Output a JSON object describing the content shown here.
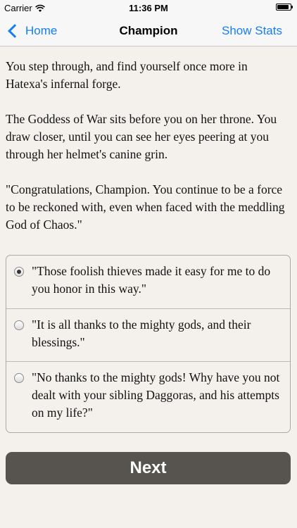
{
  "status_bar": {
    "carrier": "Carrier",
    "time": "11:36 PM",
    "wifi_icon": "wifi-icon",
    "battery_icon": "battery-icon",
    "battery_level": 0.9
  },
  "nav": {
    "back_label": "Home",
    "back_icon": "chevron-left-icon",
    "title": "Champion",
    "right_label": "Show Stats"
  },
  "story": {
    "paragraphs": [
      "You step through, and find yourself once more in Hatexa's infernal forge.",
      "The Goddess of War sits before you on her throne. You draw closer, until you can see her eyes peering at you through her helmet's canine grin.",
      "\"Congratulations, Champion. You continue to be a force to be reckoned with, even when faced with the meddling God of Chaos.\""
    ]
  },
  "choices": [
    {
      "text": "\"Those foolish thieves made it easy for me to do you honor in this way.\"",
      "selected": true
    },
    {
      "text": "\"It is all thanks to the mighty gods, and their blessings.\"",
      "selected": false
    },
    {
      "text": "\"No thanks to the mighty gods! Why have you not dealt with your sibling Daggoras, and his attempts on my life?\"",
      "selected": false
    }
  ],
  "next_label": "Next",
  "colors": {
    "accent": "#147efb",
    "background": "#f4f1ec",
    "button": "#575450"
  }
}
